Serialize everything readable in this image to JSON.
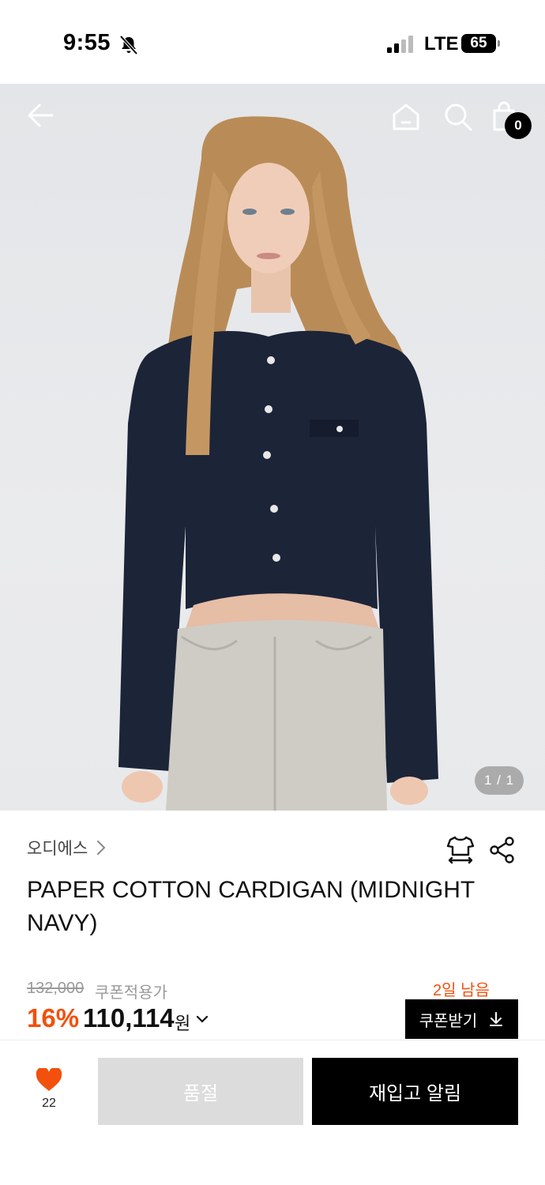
{
  "status_bar": {
    "time": "9:55",
    "network": "LTE",
    "battery": "65"
  },
  "header": {
    "back_icon": "arrow-left-icon",
    "home_icon": "home-icon",
    "search_icon": "search-icon",
    "bag_icon": "shopping-bag-icon",
    "bag_count": "0"
  },
  "gallery": {
    "indicator": "1 / 1",
    "image_alt": "Model wearing navy cropped cardigan with light grey jeans"
  },
  "product": {
    "brand": "오디에스",
    "title": "PAPER COTTON CARDIGAN (MIDNIGHT NAVY)",
    "original_price": "132,000",
    "coupon_price_label": "쿠폰적용가",
    "discount_rate": "16%",
    "sale_price": "110,114",
    "currency": "원",
    "days_left": "2일 남음",
    "coupon_button": "쿠폰받기"
  },
  "actions": {
    "like_count": "22",
    "soldout_label": "품절",
    "restock_label": "재입고 알림"
  },
  "colors": {
    "accent": "#f2500c",
    "primary": "#000000",
    "disabled": "#dcdcdc"
  }
}
